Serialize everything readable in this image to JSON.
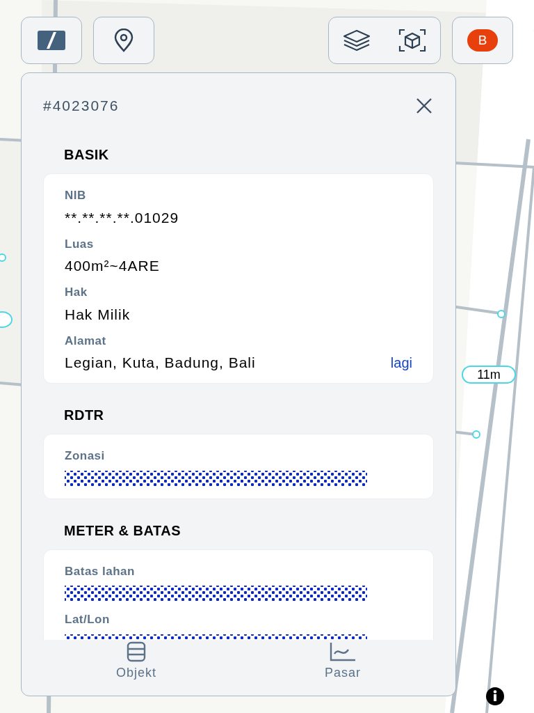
{
  "avatar": {
    "initial": "B"
  },
  "panel": {
    "title": "#4023076",
    "sections": [
      {
        "heading": "BASIK",
        "fields": [
          {
            "label": "NIB",
            "value": "**.**.**.**.01029",
            "masked": false
          },
          {
            "label": "Luas",
            "value": "400m²~4ARE",
            "masked": false
          },
          {
            "label": "Hak",
            "value": "Hak Milik",
            "masked": false
          },
          {
            "label": "Alamat",
            "value": "Legian, Kuta, Badung, Bali",
            "masked": false,
            "link": "lagi"
          }
        ]
      },
      {
        "heading": "RDTR",
        "fields": [
          {
            "label": "Zonasi",
            "masked": true
          }
        ]
      },
      {
        "heading": "METER & BATAS",
        "fields": [
          {
            "label": "Batas lahan",
            "masked": true
          },
          {
            "label": "Lat/Lon",
            "masked": true
          }
        ]
      }
    ],
    "nav": [
      {
        "kind": "objects",
        "label": "Objekt"
      },
      {
        "kind": "market",
        "label": "Pasar"
      }
    ]
  },
  "measurement": "11m"
}
